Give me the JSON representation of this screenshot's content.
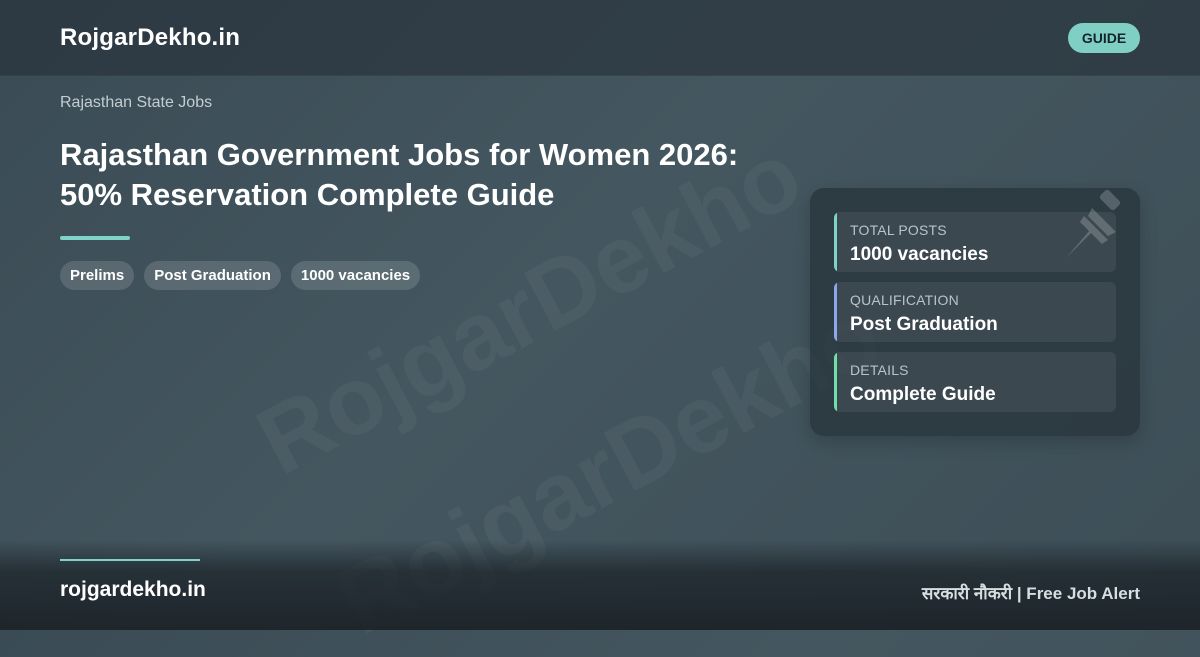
{
  "header": {
    "brand": "RojgarDekho.in",
    "badge": "GUIDE"
  },
  "watermark": "RojgarDekho",
  "article": {
    "category": "Rajasthan State Jobs",
    "title_line1": "Rajasthan Government Jobs for Women 2026:",
    "title_line2": "50% Reservation Complete Guide",
    "tags": [
      "Prelims",
      "Post Graduation",
      "1000 vacancies"
    ]
  },
  "info_panel": {
    "icon": "pushpin-icon",
    "items": [
      {
        "label": "TOTAL POSTS",
        "value": "1000 vacancies",
        "accent": "#7fd3c9"
      },
      {
        "label": "QUALIFICATION",
        "value": "Post Graduation",
        "accent": "#8aa8ef"
      },
      {
        "label": "DETAILS",
        "value": "Complete Guide",
        "accent": "#6fe0a8"
      }
    ]
  },
  "footer": {
    "site": "rojgardekho.in",
    "tagline": "सरकारी नौकरी | Free Job Alert"
  },
  "colors": {
    "accent_teal": "#7fd3c9",
    "badge_bg": "#7fcfc5",
    "background": "#3f515a"
  }
}
